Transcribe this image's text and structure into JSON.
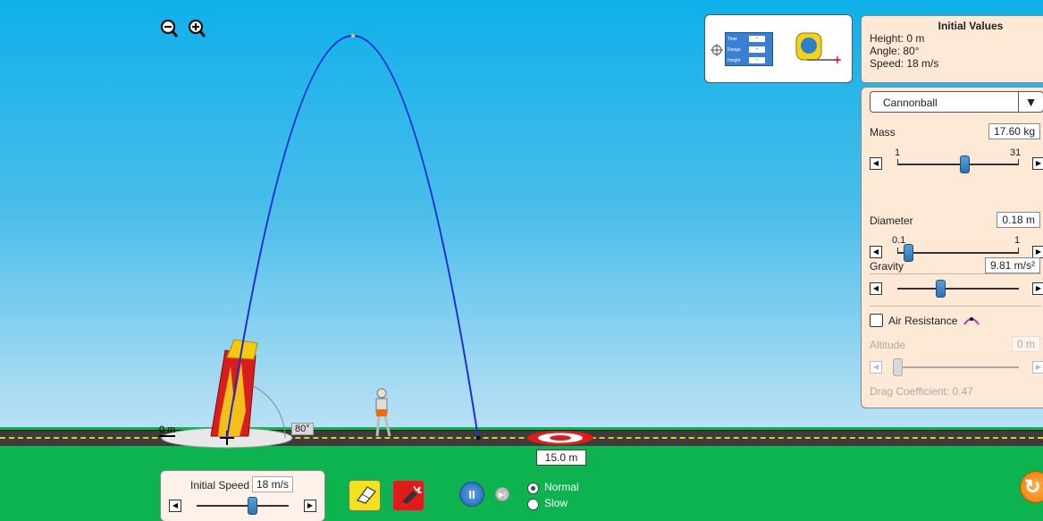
{
  "zoom": {
    "out_icon": "zoom-out-icon",
    "in_icon": "zoom-in-icon"
  },
  "trajectory": {
    "range_label": "15.0 m",
    "height_label": "0 m",
    "angle_label": "80°"
  },
  "tools": {
    "time_range_height": {
      "labels": [
        "Time",
        "Range",
        "Height"
      ],
      "values": [
        "-",
        "-",
        "-"
      ]
    },
    "tape_icon": "tape-measure-icon",
    "crosshair_icon": "crosshair-icon"
  },
  "initial_values": {
    "title": "Initial Values",
    "height": "Height: 0 m",
    "angle": "Angle: 80°",
    "speed": "Speed: 18 m/s"
  },
  "settings": {
    "projectile": "Cannonball",
    "mass": {
      "label": "Mass",
      "value": "17.60 kg",
      "min": "1",
      "max": "31",
      "level": 0.55
    },
    "diameter": {
      "label": "Diameter",
      "value": "0.18 m",
      "min": "0.1",
      "max": "1",
      "level": 0.09
    },
    "gravity": {
      "label": "Gravity",
      "value": "9.81 m/s²",
      "level": 0.35
    },
    "air_resistance": {
      "label": "Air Resistance",
      "checked": false
    },
    "altitude": {
      "label": "Altitude",
      "value": "0 m",
      "level": 0.0
    },
    "drag": "Drag Coefficient: 0.47"
  },
  "controls": {
    "initial_speed_label": "Initial Speed",
    "initial_speed_value": "18 m/s",
    "speed_level": 0.6,
    "normal": "Normal",
    "slow": "Slow",
    "selected_speed": "Normal"
  },
  "colors": {
    "trajectory": "#1f2fd0",
    "panel": "#fde9d6",
    "ground": "#0db34f"
  }
}
